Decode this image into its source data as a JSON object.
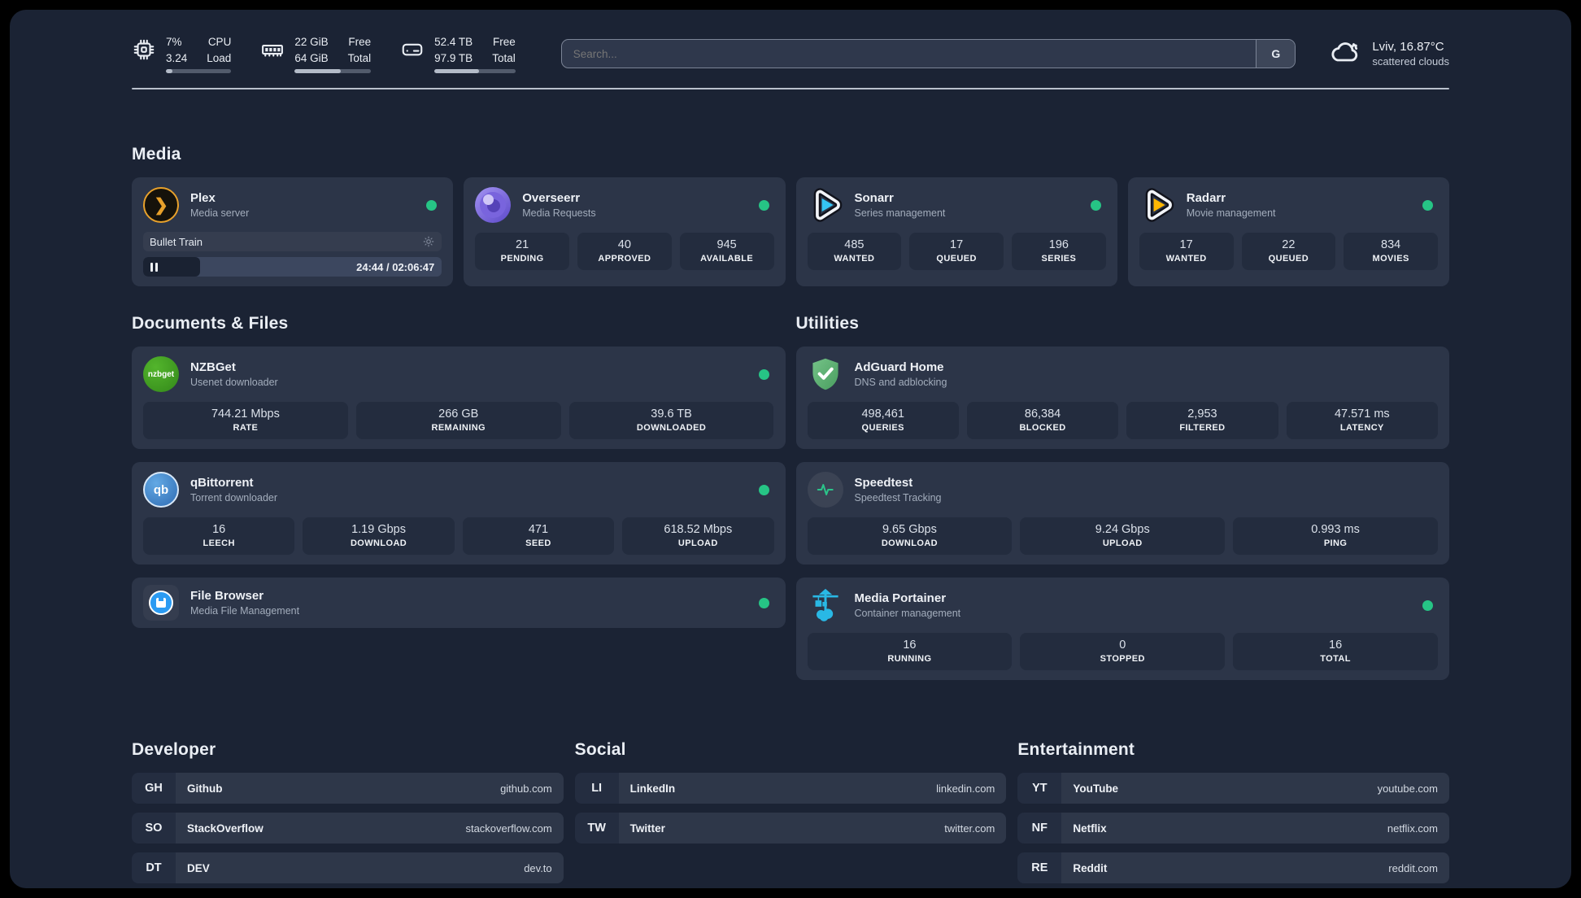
{
  "header": {
    "metrics": [
      {
        "icon": "cpu-icon",
        "v1": "7%",
        "v2": "3.24",
        "l1": "CPU",
        "l2": "Load",
        "progress": 10
      },
      {
        "icon": "ram-icon",
        "v1": "22 GiB",
        "v2": "64 GiB",
        "l1": "Free",
        "l2": "Total",
        "progress": 60
      },
      {
        "icon": "disk-icon",
        "v1": "52.4 TB",
        "v2": "97.9 TB",
        "l1": "Free",
        "l2": "Total",
        "progress": 55
      }
    ],
    "search": {
      "placeholder": "Search...",
      "button": "G"
    },
    "weather": {
      "location": "Lviv, 16.87°C",
      "condition": "scattered clouds"
    }
  },
  "media": {
    "title": "Media",
    "plex": {
      "name": "Plex",
      "desc": "Media server",
      "now_playing": "Bullet Train",
      "time": "24:44 / 02:06:47",
      "progress": 19,
      "online": true
    },
    "overseerr": {
      "name": "Overseerr",
      "desc": "Media Requests",
      "online": true,
      "stats": [
        {
          "v": "21",
          "l": "PENDING"
        },
        {
          "v": "40",
          "l": "APPROVED"
        },
        {
          "v": "945",
          "l": "AVAILABLE"
        }
      ]
    },
    "sonarr": {
      "name": "Sonarr",
      "desc": "Series management",
      "online": true,
      "stats": [
        {
          "v": "485",
          "l": "WANTED"
        },
        {
          "v": "17",
          "l": "QUEUED"
        },
        {
          "v": "196",
          "l": "SERIES"
        }
      ]
    },
    "radarr": {
      "name": "Radarr",
      "desc": "Movie management",
      "online": true,
      "stats": [
        {
          "v": "17",
          "l": "WANTED"
        },
        {
          "v": "22",
          "l": "QUEUED"
        },
        {
          "v": "834",
          "l": "MOVIES"
        }
      ]
    }
  },
  "documents": {
    "title": "Documents & Files",
    "nzbget": {
      "name": "NZBGet",
      "desc": "Usenet downloader",
      "online": true,
      "logo_text": "nzbget",
      "stats": [
        {
          "v": "744.21 Mbps",
          "l": "RATE"
        },
        {
          "v": "266 GB",
          "l": "REMAINING"
        },
        {
          "v": "39.6 TB",
          "l": "DOWNLOADED"
        }
      ]
    },
    "qbittorrent": {
      "name": "qBittorrent",
      "desc": "Torrent downloader",
      "online": true,
      "logo_text": "qb",
      "stats": [
        {
          "v": "16",
          "l": "LEECH"
        },
        {
          "v": "1.19 Gbps",
          "l": "DOWNLOAD"
        },
        {
          "v": "471",
          "l": "SEED"
        },
        {
          "v": "618.52 Mbps",
          "l": "UPLOAD"
        }
      ]
    },
    "filebrowser": {
      "name": "File Browser",
      "desc": "Media File Management",
      "online": true
    }
  },
  "utilities": {
    "title": "Utilities",
    "adguard": {
      "name": "AdGuard Home",
      "desc": "DNS and adblocking",
      "stats": [
        {
          "v": "498,461",
          "l": "QUERIES"
        },
        {
          "v": "86,384",
          "l": "BLOCKED"
        },
        {
          "v": "2,953",
          "l": "FILTERED"
        },
        {
          "v": "47.571 ms",
          "l": "LATENCY"
        }
      ]
    },
    "speedtest": {
      "name": "Speedtest",
      "desc": "Speedtest Tracking",
      "stats": [
        {
          "v": "9.65 Gbps",
          "l": "DOWNLOAD"
        },
        {
          "v": "9.24 Gbps",
          "l": "UPLOAD"
        },
        {
          "v": "0.993 ms",
          "l": "PING"
        }
      ]
    },
    "portainer": {
      "name": "Media Portainer",
      "desc": "Container management",
      "online": true,
      "stats": [
        {
          "v": "16",
          "l": "RUNNING"
        },
        {
          "v": "0",
          "l": "STOPPED"
        },
        {
          "v": "16",
          "l": "TOTAL"
        }
      ]
    }
  },
  "bookmarks": {
    "groups": [
      {
        "title": "Developer",
        "items": [
          {
            "abbr": "GH",
            "name": "Github",
            "url": "github.com"
          },
          {
            "abbr": "SO",
            "name": "StackOverflow",
            "url": "stackoverflow.com"
          },
          {
            "abbr": "DT",
            "name": "DEV",
            "url": "dev.to"
          }
        ]
      },
      {
        "title": "Social",
        "items": [
          {
            "abbr": "LI",
            "name": "LinkedIn",
            "url": "linkedin.com"
          },
          {
            "abbr": "TW",
            "name": "Twitter",
            "url": "twitter.com"
          }
        ]
      },
      {
        "title": "Entertainment",
        "items": [
          {
            "abbr": "YT",
            "name": "YouTube",
            "url": "youtube.com"
          },
          {
            "abbr": "NF",
            "name": "Netflix",
            "url": "netflix.com"
          },
          {
            "abbr": "RE",
            "name": "Reddit",
            "url": "reddit.com"
          }
        ]
      }
    ]
  },
  "colors": {
    "accent_green": "#26c485",
    "portainer_blue": "#29b8e5",
    "plex_orange": "#e8a12b",
    "sonarr_cyan": "#35c5f4",
    "radarr_yellow": "#ffb703"
  }
}
